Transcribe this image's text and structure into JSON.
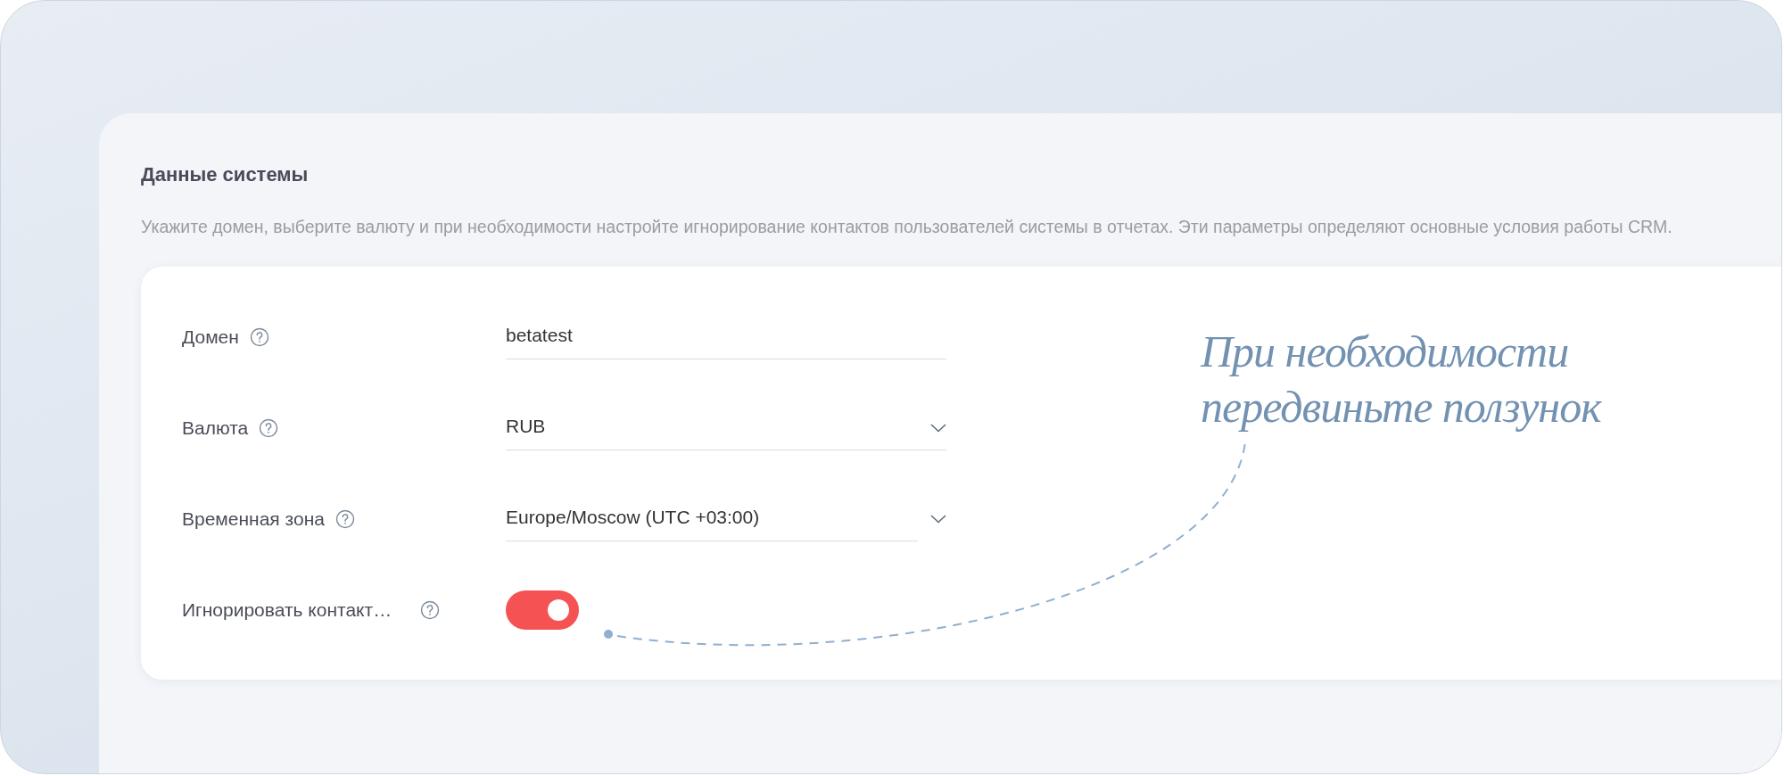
{
  "section": {
    "title": "Данные системы",
    "description": "Укажите домен, выберите валюту и при необходимости настройте игнорирование контактов пользователей системы в отчетах. Эти параметры определяют основные условия работы CRM."
  },
  "fields": [
    {
      "kind": "text",
      "label": "Домен",
      "value": "betatest"
    },
    {
      "kind": "select",
      "label": "Валюта",
      "value": "RUB"
    },
    {
      "kind": "select",
      "label": "Временная зона",
      "value": "Europe/Moscow (UTC +03:00)"
    },
    {
      "kind": "toggle",
      "label": "Игнорировать контакт…",
      "on": true
    }
  ],
  "annotation": {
    "lines": [
      "При необходимости",
      "передвиньте ползунок"
    ]
  }
}
